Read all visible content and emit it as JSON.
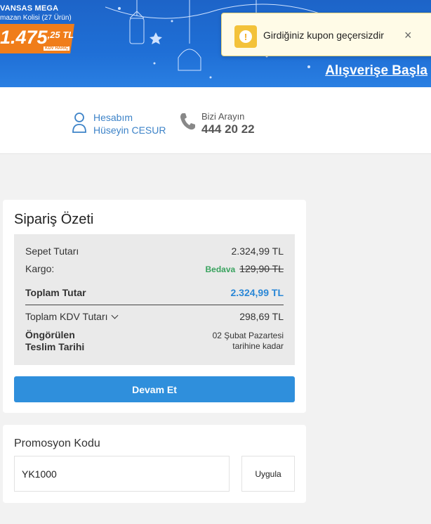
{
  "banner": {
    "brand": "VANSAS MEGA",
    "subtitle": "mazan Kolisi (27 Ürün)",
    "price_main": "1.475",
    "price_cents": ",25 TL",
    "price_note": "KDV HARİÇ",
    "cta": "Alışverişe Başla"
  },
  "toast": {
    "message": "Girdiğiniz kupon geçersizdir",
    "close": "×",
    "icon": "warning-icon",
    "icon_glyph": "!"
  },
  "header": {
    "account_label": "Hesabım",
    "account_name": "Hüseyin CESUR",
    "call_label": "Bizi Arayın",
    "call_number": "444 20 22"
  },
  "order_summary": {
    "title": "Sipariş Özeti",
    "cart_total_label": "Sepet Tutarı",
    "cart_total_value": "2.324,99 TL",
    "shipping_label": "Kargo:",
    "shipping_free": "Bedava",
    "shipping_old_price": "129,90 TL",
    "total_label": "Toplam Tutar",
    "total_value": "2.324,99 TL",
    "vat_label": "Toplam KDV Tutarı",
    "vat_value": "298,69 TL",
    "delivery_label_1": "Öngörülen",
    "delivery_label_2": "Teslim Tarihi",
    "delivery_date_1": "02 Şubat Pazartesi",
    "delivery_date_2": "tarihine kadar",
    "continue_button": "Devam Et"
  },
  "promo": {
    "title": "Promosyon Kodu",
    "code_value": "YK1000",
    "apply_button": "Uygula"
  },
  "colors": {
    "banner_blue": "#1f6fd6",
    "price_orange": "#f07d1a",
    "button_blue": "#2f8fdc",
    "free_green": "#3aa35f",
    "total_blue": "#2a87d6",
    "toast_bg": "#fffbe7"
  }
}
